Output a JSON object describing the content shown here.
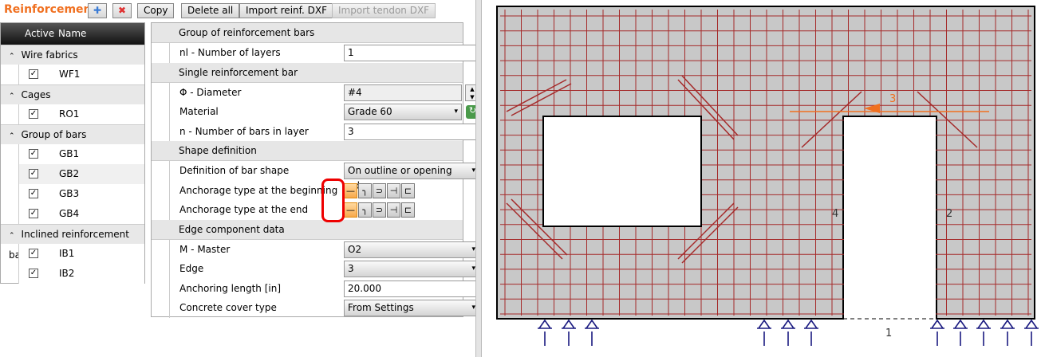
{
  "toolbar": {
    "title": "Reinforcement",
    "add": "add-icon",
    "delete": "delete-icon",
    "copy": "Copy",
    "delete_all": "Delete all",
    "import_reinf": "Import reinf. DXF",
    "import_tendon": "Import tendon DXF"
  },
  "tree": {
    "col_active": "Active",
    "col_name": "Name",
    "groups": [
      {
        "label": "Wire fabrics",
        "items": [
          "WF1"
        ]
      },
      {
        "label": "Cages",
        "items": [
          "RO1"
        ]
      },
      {
        "label": "Group of bars",
        "items": [
          "GB1",
          "GB2",
          "GB3",
          "GB4"
        ]
      },
      {
        "label": "Inclined reinforcement bars",
        "items": [
          "IB1",
          "IB2"
        ]
      }
    ]
  },
  "props": {
    "sec1": "Group of reinforcement bars",
    "layers_label": "nl - Number of layers",
    "layers": "1",
    "sec2": "Single reinforcement bar",
    "diameter_label": "Φ - Diameter",
    "diameter": "#4",
    "material_label": "Material",
    "material": "Grade 60",
    "nbars_label": "n - Number of bars in layer",
    "nbars": "3",
    "sec3": "Shape definition",
    "shape_label": "Definition of bar shape",
    "shape": "On outline or opening edge",
    "anc_begin_label": "Anchorage type at the beginning",
    "anc_end_label": "Anchorage type at the end",
    "sec4": "Edge component data",
    "master_label": "M - Master",
    "master": "O2",
    "edge_label": "Edge",
    "edge": "3",
    "anch_len_label": "Anchoring length [in]",
    "anch_len": "20.000",
    "cover_label": "Concrete cover type",
    "cover": "From Settings"
  },
  "drawing": {
    "edge_labels": [
      "1",
      "2",
      "3",
      "4"
    ],
    "bar_color": "#a52a2a",
    "concrete_color": "#c8c8c8",
    "support_color": "#1a1a80",
    "highlight_color": "#f07020"
  }
}
